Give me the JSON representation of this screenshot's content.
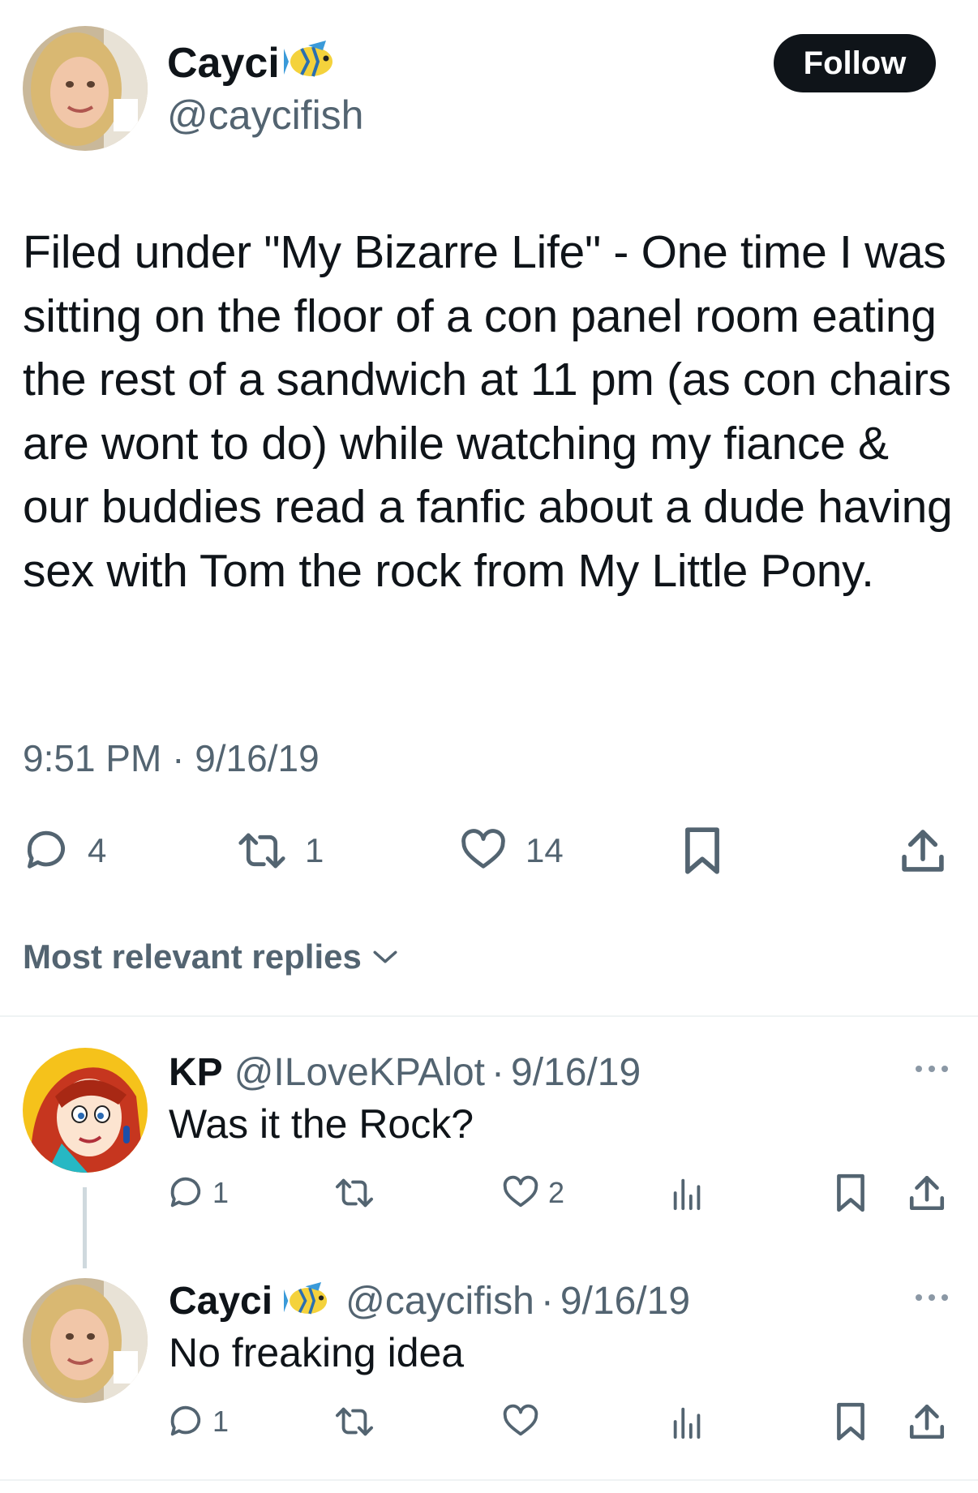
{
  "tweet": {
    "author_name": "Cayci",
    "author_handle": "@caycifish",
    "follow_label": "Follow",
    "text": "Filed under \"My Bizarre Life\" - One time I was sitting on the floor of a con panel room eating the rest of a sandwich at 11 pm (as con chairs are wont to do) while watching my fiance & our buddies read a fanfic about a dude having sex with Tom the rock from My Little Pony.",
    "timestamp": "9:51 PM · 9/16/19",
    "replies": "4",
    "retweets": "1",
    "likes": "14"
  },
  "replies_sort": {
    "label": "Most relevant replies"
  },
  "replies": [
    {
      "name": "KP",
      "handle": "@ILoveKPAlot",
      "separator": "·",
      "date": "9/16/19",
      "text": "Was it the Rock?",
      "reply_count": "1",
      "retweet_count": "",
      "like_count": "2"
    },
    {
      "name": "Cayci",
      "handle": "@caycifish",
      "separator": "·",
      "date": "9/16/19",
      "text": "No freaking idea",
      "reply_count": "1",
      "retweet_count": "",
      "like_count": ""
    }
  ],
  "icons": {
    "verified_emoji": "tropical-fish-icon",
    "reply": "reply-icon",
    "retweet": "retweet-icon",
    "like": "heart-icon",
    "bookmark": "bookmark-icon",
    "share": "share-icon",
    "views": "views-icon",
    "more": "more-icon"
  },
  "colors": {
    "text": "#0f1419",
    "secondary": "#536471",
    "follow_bg": "#0f1419",
    "divider": "#eff3f4"
  }
}
